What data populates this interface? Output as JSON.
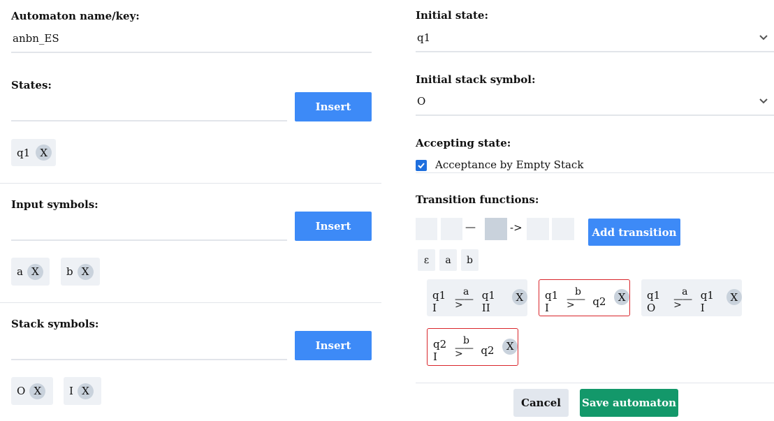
{
  "left": {
    "automaton_name": {
      "label": "Automaton name/key:",
      "value": "anbn_ES"
    },
    "states": {
      "label": "States:",
      "insert_label": "Insert",
      "items": [
        "q1"
      ]
    },
    "input_symbols": {
      "label": "Input symbols:",
      "insert_label": "Insert",
      "items": [
        "a",
        "b"
      ]
    },
    "stack_symbols": {
      "label": "Stack symbols:",
      "insert_label": "Insert",
      "items": [
        "O",
        "I"
      ]
    }
  },
  "right": {
    "initial_state": {
      "label": "Initial state:",
      "value": "q1"
    },
    "initial_stack_symbol": {
      "label": "Initial stack symbol:",
      "value": "O"
    },
    "accepting_state": {
      "label": "Accepting state:",
      "checkbox_label": "Acceptance by Empty Stack",
      "checked": true
    },
    "transition_functions": {
      "label": "Transition functions:",
      "dash": "—",
      "arrow": "->",
      "add_label": "Add transition",
      "symbols": [
        "ε",
        "a",
        "b"
      ],
      "transitions": [
        {
          "from": "q1 I",
          "input": "a",
          "to": "q1 II",
          "error": false
        },
        {
          "from": "q1 I",
          "input": "b",
          "to": "q2",
          "error": true
        },
        {
          "from": "q1 O",
          "input": "a",
          "to": "q1 I",
          "error": false
        },
        {
          "from": "q2 I",
          "input": "b",
          "to": "q2",
          "error": true
        }
      ]
    },
    "cancel_label": "Cancel",
    "save_label": "Save automaton"
  },
  "remove_glyph": "X",
  "colors": {
    "accent": "#3d8af7",
    "save": "#13986a",
    "error_border": "#d9252b",
    "chip_bg": "#eef1f5"
  }
}
